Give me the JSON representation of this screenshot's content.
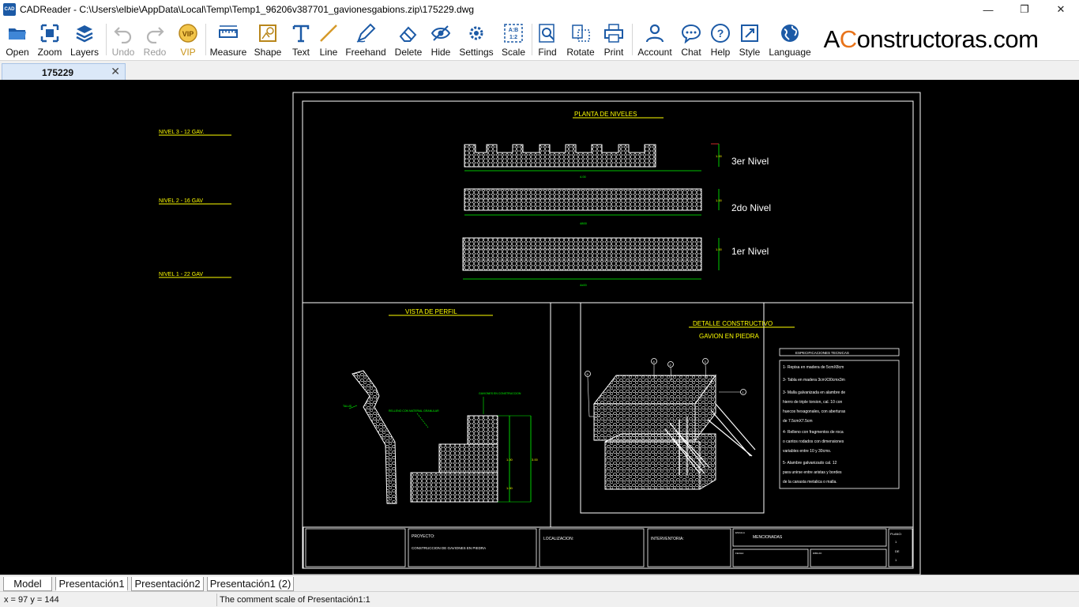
{
  "window": {
    "title": "CADReader - C:\\Users\\elbie\\AppData\\Local\\Temp\\Temp1_96206v387701_gavionesgabions.zip\\175229.dwg",
    "logo_text": "CAD",
    "minimize": "—",
    "maximize": "❐",
    "close": "✕"
  },
  "toolbar": {
    "open": "Open",
    "zoom": "Zoom",
    "layers": "Layers",
    "undo": "Undo",
    "redo": "Redo",
    "vip": "VIP",
    "measure": "Measure",
    "shape": "Shape",
    "text": "Text",
    "line": "Line",
    "freehand": "Freehand",
    "delete": "Delete",
    "hide": "Hide",
    "settings": "Settings",
    "scale": "Scale",
    "find": "Find",
    "rotate": "Rotate",
    "print": "Print",
    "account": "Account",
    "chat": "Chat",
    "help": "Help",
    "style": "Style",
    "language": "Language",
    "vip_badge": "VIP",
    "scale_badge_top": "A:B",
    "scale_badge_bottom": "1:2"
  },
  "brand": {
    "prefix": "A",
    "accent": "C",
    "rest": "onstructoras.com"
  },
  "document_tab": {
    "label": "175229",
    "close": "✕"
  },
  "drawing": {
    "left_labels": [
      "NIVEL 3 - 12 GAV.",
      "NIVEL 2 - 16 GAV",
      "NIVEL 1 - 22 GAV"
    ],
    "plan_title": "PLANTA DE NIVELES",
    "level_labels": [
      "3er Nivel",
      "2do Nivel",
      "1er Nivel"
    ],
    "level_dims": [
      "4.00",
      "4800",
      "4x00"
    ],
    "level_heights": [
      "1.00",
      "1.00",
      "1.00"
    ],
    "profile_title": "VISTA DE PERFIL",
    "profile_notes": [
      "GAVIONES EN CONSTRUCCION",
      "RELLENO CON MATERIAL GRANULAR",
      "TALUD"
    ],
    "profile_dims": [
      "1.00",
      "1.00",
      "3.00"
    ],
    "detail_title_1": "DETALLE CONSTRUCTIVO",
    "detail_title_2": "GAVION EN PIEDRA",
    "detail_callouts": [
      "5",
      "4",
      "2",
      "3",
      "1"
    ],
    "specs_title": "ESPECIFICACIONES TECNICAS",
    "specs": [
      "1- Repisa en madera de 5cmX8cm",
      "3- Tabla en madera 3cmX30cmx3m",
      "3- Malla galvanizada en alambre de",
      "hierro de triple torsion, cal. 10 con",
      "huecos hexagonales, con aberturas",
      "de 7.5cmX7.5cm",
      "4- Relleno con fragmentos de roca",
      "o cantos rodados con dimensiones",
      "variables entre 10 y 30cms.",
      "5- Alambre galvanizado cal. 12",
      "para unirse entre aristas y bordes",
      "de la canasta metalica o malla."
    ],
    "title_block": {
      "project_label": "PROYECTO:",
      "project_value": "CONSTRUCCION DE GAVIONES EN PIEDRA",
      "location_label": "LOCALIZACION:",
      "interventor_label": "INTERVENTORIA:",
      "scale_label": "ESCALA",
      "scale_value": "MENCIONADAS",
      "sheet_label": "PLANO:",
      "sheet_no": "1",
      "sheet_of": "DE",
      "sheet_total": "1",
      "date_label": "FECHA:",
      "draw_label": "DIBUJO:"
    }
  },
  "layout_tabs": [
    "Model",
    "Presentación1",
    "Presentación2",
    "Presentación1 (2)"
  ],
  "status": {
    "coords": "x = 97 y = 144",
    "message": "The comment scale of Presentación1:1"
  },
  "colors": {
    "accent": "#1c5aa6",
    "brand_accent": "#e8731a",
    "cad_yellow": "#ffff00",
    "cad_green": "#00ff00"
  }
}
